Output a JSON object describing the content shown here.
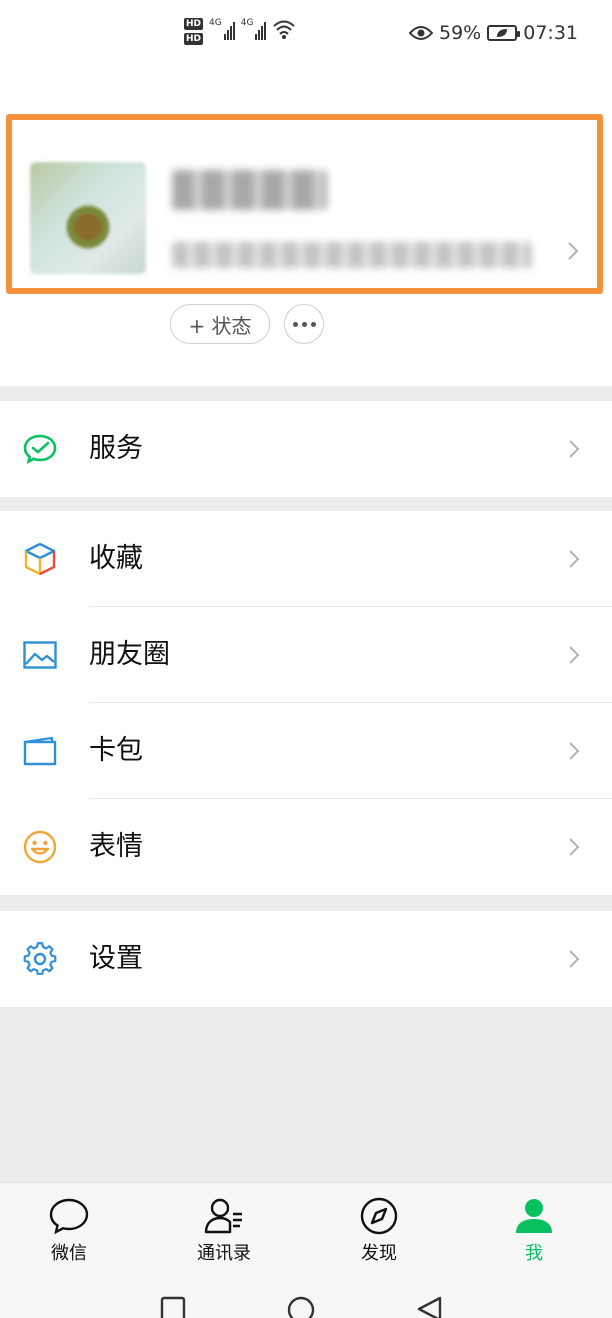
{
  "status_bar": {
    "hd_badges": [
      "HD",
      "HD"
    ],
    "signal_labels": [
      "4G",
      "4G"
    ],
    "battery": "59%",
    "time": "07:31",
    "icons": [
      "hd-icon",
      "signal-icon",
      "wifi-icon",
      "eye-icon",
      "battery-icon"
    ]
  },
  "profile": {
    "status_button": "+ 状态",
    "more_button_icon": "more-dots-icon"
  },
  "menu": {
    "services": {
      "label": "服务",
      "icon": "wechat-pay-icon"
    },
    "favorites": {
      "label": "收藏",
      "icon": "cube-icon"
    },
    "moments": {
      "label": "朋友圈",
      "icon": "image-icon"
    },
    "cards": {
      "label": "卡包",
      "icon": "wallet-icon"
    },
    "stickers": {
      "label": "表情",
      "icon": "smiley-icon"
    },
    "settings": {
      "label": "设置",
      "icon": "gear-icon"
    }
  },
  "tabbar": {
    "tabs": [
      {
        "label": "微信",
        "icon": "chat-bubble-icon",
        "active": false
      },
      {
        "label": "通讯录",
        "icon": "contacts-icon",
        "active": false
      },
      {
        "label": "发现",
        "icon": "compass-icon",
        "active": false
      },
      {
        "label": "我",
        "icon": "person-icon",
        "active": true
      }
    ]
  },
  "colors": {
    "accent_green": "#07c160",
    "highlight_orange": "#f5913a",
    "background": "#ededed"
  }
}
